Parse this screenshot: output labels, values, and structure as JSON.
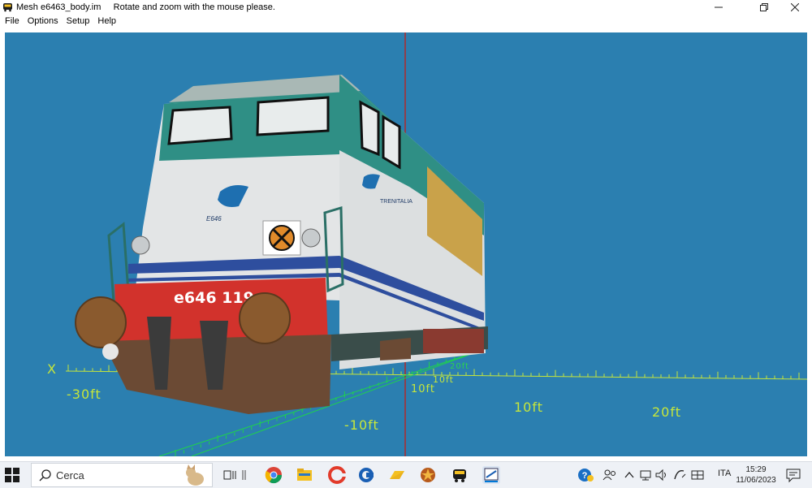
{
  "window": {
    "title": "Mesh e6463_body.im     Rotate and zoom with the mouse please.",
    "minimize_icon": "minimize-icon",
    "restore_icon": "restore-icon",
    "close_icon": "close-icon"
  },
  "menu": {
    "items": [
      "File",
      "Options",
      "Setup",
      "Help"
    ]
  },
  "viewport": {
    "background": "#2b7fb0",
    "axis_color": "#c6e63b",
    "axis_x_label": "X",
    "labels": [
      "-30ft",
      "-10ft",
      "10ft",
      "20ft",
      "10ft",
      "20ft",
      "10ft"
    ],
    "locomotive": {
      "number_text": "e646  119",
      "side_brand": "TRENITALIA",
      "front_model": "E646"
    }
  },
  "taskbar": {
    "search_text": "Cerca",
    "tray_lang": "ITA",
    "time": "15:29",
    "date": "11/06/2023",
    "colors": {
      "taskbar_bg": "#eef1f6",
      "accent": "#0078d7"
    }
  }
}
